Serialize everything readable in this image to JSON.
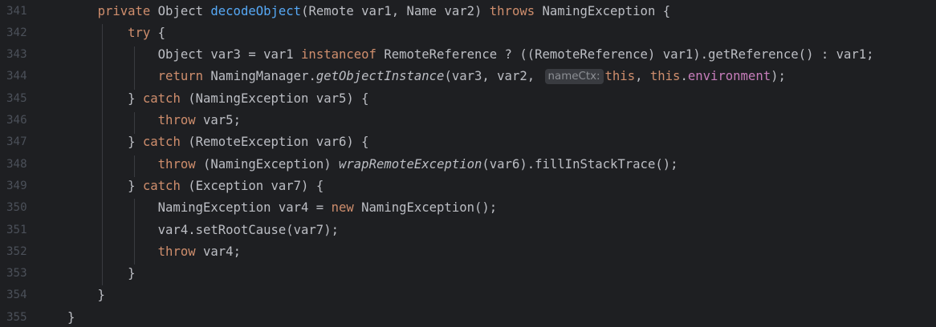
{
  "editor": {
    "line_numbers": [
      "341",
      "342",
      "343",
      "344",
      "345",
      "346",
      "347",
      "348",
      "349",
      "350",
      "351",
      "352",
      "353",
      "354",
      "355"
    ],
    "lines": [
      {
        "tokens": [
          {
            "t": "    "
          },
          {
            "t": "private",
            "c": "kw"
          },
          {
            "t": " Object "
          },
          {
            "t": "decodeObject",
            "c": "fn"
          },
          {
            "t": "(Remote var1, Name var2) "
          },
          {
            "t": "throws",
            "c": "kw"
          },
          {
            "t": " NamingException {"
          }
        ]
      },
      {
        "tokens": [
          {
            "t": "        "
          },
          {
            "t": "try",
            "c": "kw"
          },
          {
            "t": " {"
          }
        ]
      },
      {
        "tokens": [
          {
            "t": "            Object var3 = var1 "
          },
          {
            "t": "instanceof",
            "c": "kw"
          },
          {
            "t": " RemoteReference ? ((RemoteReference) var1).getReference() : var1;"
          }
        ]
      },
      {
        "tokens": [
          {
            "t": "            "
          },
          {
            "t": "return",
            "c": "kw"
          },
          {
            "t": " NamingManager."
          },
          {
            "t": "getObjectInstance",
            "c": "italic"
          },
          {
            "t": "(var3, var2, "
          },
          {
            "t": "nameCtx:",
            "c": "hint"
          },
          {
            "t": "this",
            "c": "kw"
          },
          {
            "t": ", "
          },
          {
            "t": "this",
            "c": "kw"
          },
          {
            "t": "."
          },
          {
            "t": "environment",
            "c": "field"
          },
          {
            "t": ");"
          }
        ]
      },
      {
        "tokens": [
          {
            "t": "        } "
          },
          {
            "t": "catch",
            "c": "kw"
          },
          {
            "t": " (NamingException var5) {"
          }
        ]
      },
      {
        "tokens": [
          {
            "t": "            "
          },
          {
            "t": "throw",
            "c": "kw"
          },
          {
            "t": " var5;"
          }
        ]
      },
      {
        "tokens": [
          {
            "t": "        } "
          },
          {
            "t": "catch",
            "c": "kw"
          },
          {
            "t": " (RemoteException var6) {"
          }
        ]
      },
      {
        "tokens": [
          {
            "t": "            "
          },
          {
            "t": "throw",
            "c": "kw"
          },
          {
            "t": " (NamingException) "
          },
          {
            "t": "wrapRemoteException",
            "c": "italic"
          },
          {
            "t": "(var6).fillInStackTrace();"
          }
        ]
      },
      {
        "tokens": [
          {
            "t": "        } "
          },
          {
            "t": "catch",
            "c": "kw"
          },
          {
            "t": " (Exception var7) {"
          }
        ]
      },
      {
        "tokens": [
          {
            "t": "            NamingException var4 = "
          },
          {
            "t": "new",
            "c": "kw"
          },
          {
            "t": " NamingException();"
          }
        ]
      },
      {
        "tokens": [
          {
            "t": "            var4.setRootCause(var7);"
          }
        ]
      },
      {
        "tokens": [
          {
            "t": "            "
          },
          {
            "t": "throw",
            "c": "kw"
          },
          {
            "t": " var4;"
          }
        ]
      },
      {
        "tokens": [
          {
            "t": "        }"
          }
        ]
      },
      {
        "tokens": [
          {
            "t": "    }"
          }
        ]
      },
      {
        "tokens": [
          {
            "t": "}"
          }
        ]
      }
    ]
  },
  "colors": {
    "background": "#1e1f22",
    "line_number": "#4b5059",
    "text": "#bcbec4",
    "keyword": "#cf8e6d",
    "method": "#56a8f5",
    "field": "#c77dbb",
    "hint_background": "#393b40",
    "hint_text": "#8c8f94"
  }
}
